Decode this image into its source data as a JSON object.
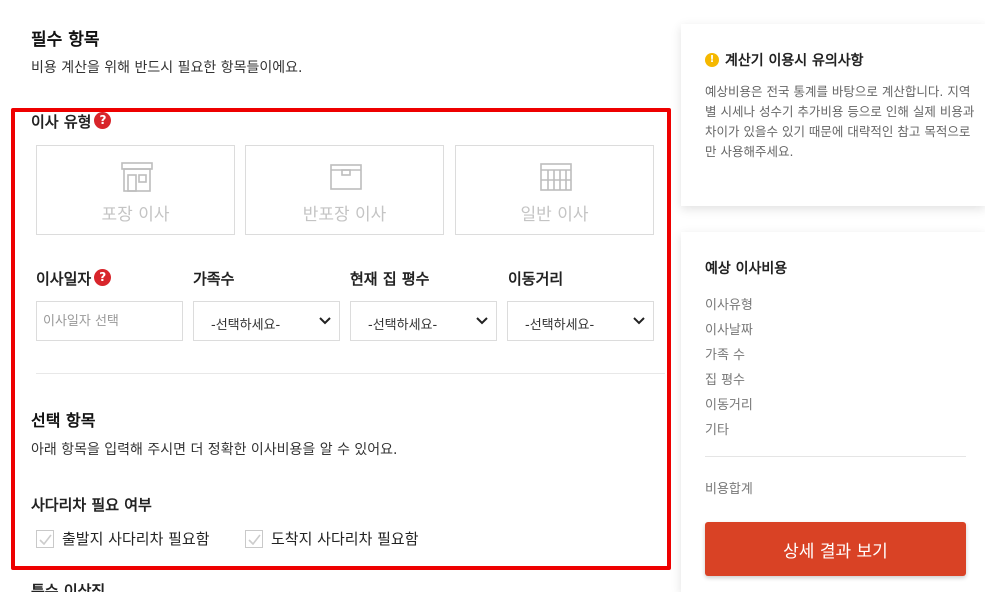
{
  "required": {
    "title": "필수 항목",
    "desc": "비용 계산을 위해 반드시 필요한 항목들이에요."
  },
  "move_type": {
    "label": "이사 유형",
    "help": "?",
    "options": [
      {
        "label": "포장 이사",
        "icon": "storefront-icon"
      },
      {
        "label": "반포장 이사",
        "icon": "box-icon"
      },
      {
        "label": "일반 이사",
        "icon": "crate-icon"
      }
    ]
  },
  "fields": {
    "date": {
      "label": "이사일자",
      "help": "?",
      "placeholder": "이사일자 선택"
    },
    "family": {
      "label": "가족수",
      "value": "-선택하세요-"
    },
    "size": {
      "label": "현재 집 평수",
      "value": "-선택하세요-"
    },
    "distance": {
      "label": "이동거리",
      "value": "-선택하세요-"
    }
  },
  "optional": {
    "title": "선택 항목",
    "desc": "아래 항목을 입력해 주시면 더 정확한 이사비용을 알 수 있어요."
  },
  "ladder": {
    "title": "사다리차 필요 여부",
    "options": [
      "출발지 사다리차 필요함",
      "도착지 사다리차 필요함"
    ]
  },
  "next_section_title": "특수 이삿짐",
  "notice": {
    "icon": "!",
    "title": "계산기 이용시 유의사항",
    "body": "예상비용은 전국 통계를 바탕으로 계산합니다. 지역별 시세나 성수기 추가비용 등으로 인해 실제 비용과 차이가 있을수 있기 때문에 대략적인 참고 목적으로만 사용해주세요."
  },
  "estimate": {
    "title": "예상 이사비용",
    "items": [
      "이사유형",
      "이사날짜",
      "가족 수",
      "집 평수",
      "이동거리",
      "기타"
    ],
    "total_label": "비용합계",
    "button_label": "상세 결과 보기"
  },
  "colors": {
    "highlight": "#ee0000",
    "help_badge": "#d8252b",
    "warn_badge": "#f5b800",
    "cta_button": "#d94225"
  }
}
